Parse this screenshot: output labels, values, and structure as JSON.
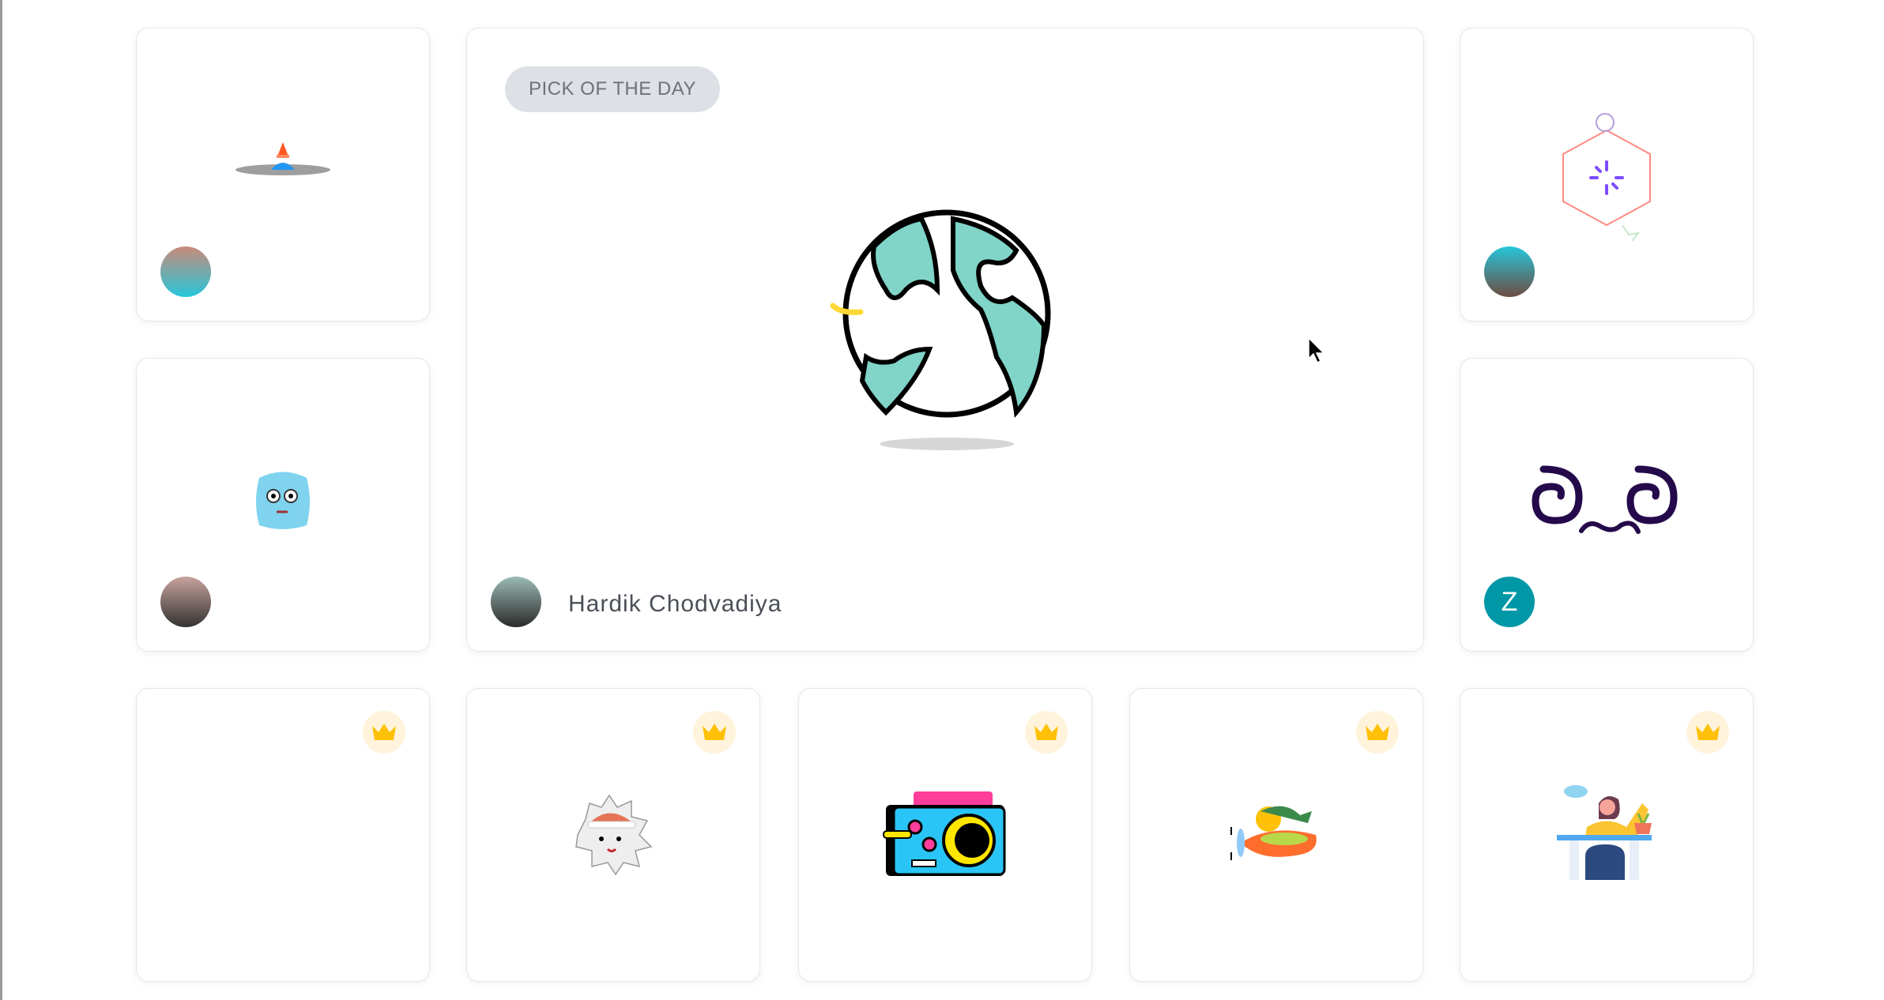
{
  "featured": {
    "badge": "PICK OF THE DAY",
    "author": "Hardik Chodvadiya",
    "illustration": "globe"
  },
  "cards": [
    {
      "illustration": "traffic-cone-hole",
      "avatar": "photo"
    },
    {
      "illustration": "hexagon-sparkle",
      "avatar": "photo"
    },
    {
      "illustration": "blue-cube-face",
      "avatar": "photo"
    },
    {
      "illustration": "dizzy-eyes",
      "avatar_initial": "Z",
      "avatar_color": "#0097a7"
    }
  ],
  "premium_cards": [
    {
      "illustration": "empty",
      "premium": true
    },
    {
      "illustration": "hedgehog-santa-hat",
      "premium": true
    },
    {
      "illustration": "camera",
      "premium": true
    },
    {
      "illustration": "bird-airplane",
      "premium": true
    },
    {
      "illustration": "woman-at-desk",
      "premium": true
    }
  ],
  "colors": {
    "crown": "#ffc107",
    "crown_bg": "#fff3dc",
    "badge_bg": "#dde1e6",
    "globe_land": "#80d4c8"
  }
}
